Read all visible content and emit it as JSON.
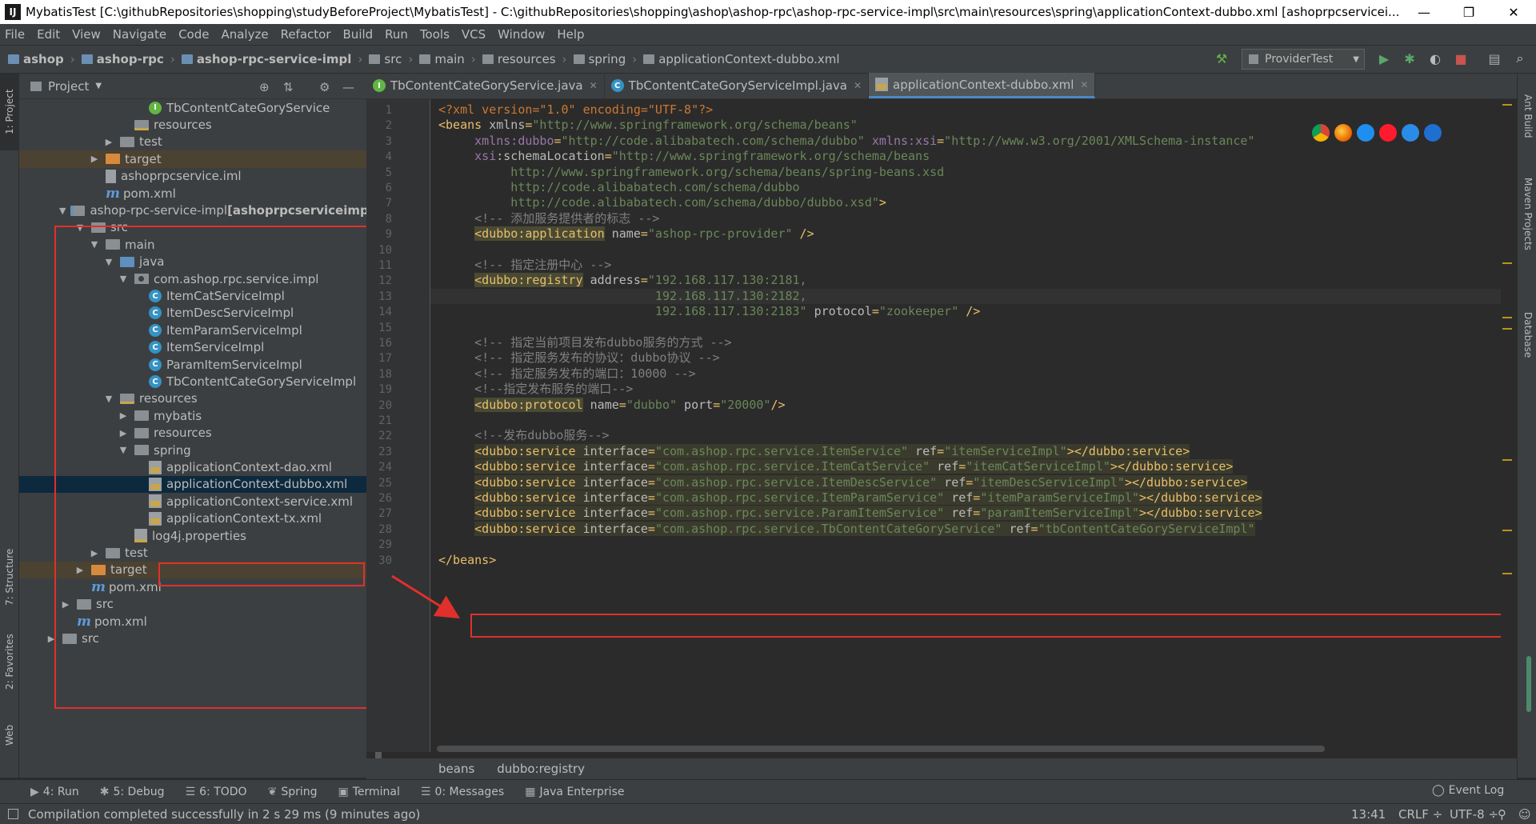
{
  "window": {
    "title": "MybatisTest [C:\\githubRepositories\\shopping\\studyBeforeProject\\MybatisTest] - C:\\githubRepositories\\shopping\\ashop\\ashop-rpc\\ashop-rpc-service-impl\\src\\main\\resources\\spring\\applicationContext-dubbo.xml [ashoprpcservicei...",
    "minimize": "—",
    "restore": "❐",
    "close": "✕"
  },
  "menu": [
    "File",
    "Edit",
    "View",
    "Navigate",
    "Code",
    "Analyze",
    "Refactor",
    "Build",
    "Run",
    "Tools",
    "VCS",
    "Window",
    "Help"
  ],
  "breadcrumb": [
    "ashop",
    "ashop-rpc",
    "ashop-rpc-service-impl",
    "src",
    "main",
    "resources",
    "spring",
    "applicationContext-dubbo.xml"
  ],
  "run_config": "ProviderTest",
  "project_panel": {
    "title": "Project",
    "tree": [
      {
        "label": "TbContentCateGoryService",
        "icon": "interface-icon",
        "indent": 7
      },
      {
        "label": "resources",
        "icon": "resources-folder-icon",
        "indent": 6
      },
      {
        "label": "test",
        "icon": "folder-icon",
        "indent": 5,
        "arrow": "▶"
      },
      {
        "label": "target",
        "icon": "target-folder-icon",
        "indent": 4,
        "arrow": "▶",
        "excluded": true
      },
      {
        "label": "ashoprpcservice.iml",
        "icon": "iml-file-icon",
        "indent": 4
      },
      {
        "label": "pom.xml",
        "icon": "maven-icon",
        "indent": 4
      },
      {
        "label": "ashop-rpc-service-impl",
        "suffix": " [ashoprpcserviceimpl]",
        "icon": "module-folder-icon",
        "indent": 2,
        "arrow": "▼"
      },
      {
        "label": "src",
        "icon": "folder-icon",
        "indent": 3,
        "arrow": "▼"
      },
      {
        "label": "main",
        "icon": "folder-icon",
        "indent": 4,
        "arrow": "▼"
      },
      {
        "label": "java",
        "icon": "source-folder-icon",
        "indent": 5,
        "arrow": "▼"
      },
      {
        "label": "com.ashop.rpc.service.impl",
        "icon": "package-icon",
        "indent": 6,
        "arrow": "▼"
      },
      {
        "label": "ItemCatServiceImpl",
        "icon": "class-icon",
        "indent": 7
      },
      {
        "label": "ItemDescServiceImpl",
        "icon": "class-icon",
        "indent": 7
      },
      {
        "label": "ItemParamServiceImpl",
        "icon": "class-icon",
        "indent": 7
      },
      {
        "label": "ItemServiceImpl",
        "icon": "class-icon",
        "indent": 7
      },
      {
        "label": "ParamItemServiceImpl",
        "icon": "class-icon",
        "indent": 7
      },
      {
        "label": "TbContentCateGoryServiceImpl",
        "icon": "class-icon",
        "indent": 7
      },
      {
        "label": "resources",
        "icon": "resources-folder-icon",
        "indent": 5,
        "arrow": "▼"
      },
      {
        "label": "mybatis",
        "icon": "folder-icon",
        "indent": 6,
        "arrow": "▶"
      },
      {
        "label": "resources",
        "icon": "folder-icon",
        "indent": 6,
        "arrow": "▶"
      },
      {
        "label": "spring",
        "icon": "folder-icon",
        "indent": 6,
        "arrow": "▼"
      },
      {
        "label": "applicationContext-dao.xml",
        "icon": "xml-file-icon",
        "indent": 7
      },
      {
        "label": "applicationContext-dubbo.xml",
        "icon": "xml-file-icon",
        "indent": 7,
        "selected": true
      },
      {
        "label": "applicationContext-service.xml",
        "icon": "xml-file-icon",
        "indent": 7
      },
      {
        "label": "applicationContext-tx.xml",
        "icon": "xml-file-icon",
        "indent": 7
      },
      {
        "label": "log4j.properties",
        "icon": "properties-file-icon",
        "indent": 6
      },
      {
        "label": "test",
        "icon": "folder-icon",
        "indent": 4,
        "arrow": "▶"
      },
      {
        "label": "target",
        "icon": "target-folder-icon",
        "indent": 3,
        "arrow": "▶",
        "excluded": true
      },
      {
        "label": "pom.xml",
        "icon": "maven-icon",
        "indent": 3
      },
      {
        "label": "src",
        "icon": "folder-icon",
        "indent": 2,
        "arrow": "▶"
      },
      {
        "label": "pom.xml",
        "icon": "maven-icon",
        "indent": 2
      },
      {
        "label": "src",
        "icon": "folder-icon",
        "indent": 1,
        "arrow": "▶"
      }
    ]
  },
  "tabs": [
    {
      "label": "TbContentCateGoryService.java",
      "icon": "interface-icon",
      "active": false
    },
    {
      "label": "TbContentCateGoryServiceImpl.java",
      "icon": "class-icon",
      "active": false
    },
    {
      "label": "applicationContext-dubbo.xml",
      "icon": "xml-file-icon",
      "active": true
    }
  ],
  "editor": {
    "lines": [
      [
        [
          "pi",
          "<?xml version=\"1.0\" encoding=\"UTF-8\"?>"
        ]
      ],
      [
        [
          "tag",
          "<beans "
        ],
        [
          "attr",
          "xmlns"
        ],
        [
          "tag",
          "="
        ],
        [
          "val",
          "\"http://www.springframework.org/schema/beans\""
        ]
      ],
      [
        [
          "txt",
          "     "
        ],
        [
          "ns",
          "xmlns:dubbo"
        ],
        [
          "tag",
          "="
        ],
        [
          "val",
          "\"http://code.alibabatech.com/schema/dubbo\""
        ],
        [
          "txt",
          " "
        ],
        [
          "ns",
          "xmlns:xsi"
        ],
        [
          "tag",
          "="
        ],
        [
          "val",
          "\"http://www.w3.org/2001/XMLSchema-instance\""
        ]
      ],
      [
        [
          "txt",
          "     "
        ],
        [
          "ns",
          "xsi"
        ],
        [
          "attr",
          ":schemaLocation"
        ],
        [
          "tag",
          "="
        ],
        [
          "val",
          "\"http://www.springframework.org/schema/beans"
        ]
      ],
      [
        [
          "val",
          "          http://www.springframework.org/schema/beans/spring-beans.xsd"
        ]
      ],
      [
        [
          "val",
          "          http://code.alibabatech.com/schema/dubbo"
        ]
      ],
      [
        [
          "val",
          "          http://code.alibabatech.com/schema/dubbo/dubbo.xsd\""
        ],
        [
          "tag",
          ">"
        ]
      ],
      [
        [
          "com",
          "     <!-- 添加服务提供者的标志 -->"
        ]
      ],
      [
        [
          "txt",
          "     "
        ],
        [
          "tagbg",
          "<dubbo:application"
        ],
        [
          "attr",
          " name"
        ],
        [
          "tag",
          "="
        ],
        [
          "val",
          "\"ashop-rpc-provider\""
        ],
        [
          "tag",
          " />"
        ]
      ],
      [],
      [
        [
          "com",
          "     <!-- 指定注册中心 -->"
        ]
      ],
      [
        [
          "txt",
          "     "
        ],
        [
          "tagbg",
          "<dubbo:registry"
        ],
        [
          "attr",
          " address"
        ],
        [
          "tag",
          "="
        ],
        [
          "val",
          "\"192.168.117.130:2181,"
        ]
      ],
      [
        [
          "val",
          "                              192.168.117.130:2182,"
        ]
      ],
      [
        [
          "val",
          "                              192.168.117.130:2183\""
        ],
        [
          "attr",
          " protocol"
        ],
        [
          "tag",
          "="
        ],
        [
          "val",
          "\"zookeeper\""
        ],
        [
          "tag",
          " />"
        ]
      ],
      [],
      [
        [
          "com",
          "     <!-- 指定当前项目发布dubbo服务的方式 -->"
        ]
      ],
      [
        [
          "com",
          "     <!-- 指定服务发布的协议：dubbo协议 -->"
        ]
      ],
      [
        [
          "com",
          "     <!-- 指定服务发布的端口：10000 -->"
        ]
      ],
      [
        [
          "com",
          "     <!--指定发布服务的端口-->"
        ]
      ],
      [
        [
          "txt",
          "     "
        ],
        [
          "tagbg",
          "<dubbo:protocol"
        ],
        [
          "attr",
          " name"
        ],
        [
          "tag",
          "="
        ],
        [
          "val",
          "\"dubbo\""
        ],
        [
          "attr",
          " port"
        ],
        [
          "tag",
          "="
        ],
        [
          "val",
          "\"20000\""
        ],
        [
          "tag",
          "/>"
        ]
      ],
      [],
      [
        [
          "com",
          "     <!--发布dubbo服务-->"
        ]
      ],
      [
        [
          "txt",
          "     "
        ],
        [
          "bgtag",
          "<dubbo:service"
        ],
        [
          "bgattr",
          " interface"
        ],
        [
          "bgtag",
          "="
        ],
        [
          "bgval",
          "\"com.ashop.rpc.service.ItemService\""
        ],
        [
          "bgattr",
          " ref"
        ],
        [
          "bgtag",
          "="
        ],
        [
          "bgval",
          "\"itemServiceImpl\""
        ],
        [
          "bgtag",
          "></dubbo:service>"
        ]
      ],
      [
        [
          "txt",
          "     "
        ],
        [
          "bgtag",
          "<dubbo:service"
        ],
        [
          "bgattr",
          " interface"
        ],
        [
          "bgtag",
          "="
        ],
        [
          "bgval",
          "\"com.ashop.rpc.service.ItemCatService\""
        ],
        [
          "bgattr",
          " ref"
        ],
        [
          "bgtag",
          "="
        ],
        [
          "bgval",
          "\"itemCatServiceImpl\""
        ],
        [
          "bgtag",
          "></dubbo:service>"
        ]
      ],
      [
        [
          "txt",
          "     "
        ],
        [
          "bgtag",
          "<dubbo:service"
        ],
        [
          "bgattr",
          " interface"
        ],
        [
          "bgtag",
          "="
        ],
        [
          "bgval",
          "\"com.ashop.rpc.service.ItemDescService\""
        ],
        [
          "bgattr",
          " ref"
        ],
        [
          "bgtag",
          "="
        ],
        [
          "bgval",
          "\"itemDescServiceImpl\""
        ],
        [
          "bgtag",
          "></dubbo:service>"
        ]
      ],
      [
        [
          "txt",
          "     "
        ],
        [
          "bgtag",
          "<dubbo:service"
        ],
        [
          "bgattr",
          " interface"
        ],
        [
          "bgtag",
          "="
        ],
        [
          "bgval",
          "\"com.ashop.rpc.service.ItemParamService\""
        ],
        [
          "bgattr",
          " ref"
        ],
        [
          "bgtag",
          "="
        ],
        [
          "bgval",
          "\"itemParamServiceImpl\""
        ],
        [
          "bgtag",
          "></dubbo:service>"
        ]
      ],
      [
        [
          "txt",
          "     "
        ],
        [
          "bgtag",
          "<dubbo:service"
        ],
        [
          "bgattr",
          " interface"
        ],
        [
          "bgtag",
          "="
        ],
        [
          "bgval",
          "\"com.ashop.rpc.service.ParamItemService\""
        ],
        [
          "bgattr",
          " ref"
        ],
        [
          "bgtag",
          "="
        ],
        [
          "bgval",
          "\"paramItemServiceImpl\""
        ],
        [
          "bgtag",
          "></dubbo:service>"
        ]
      ],
      [
        [
          "txt",
          "     "
        ],
        [
          "bgtag",
          "<dubbo:service"
        ],
        [
          "bgattr",
          " interface"
        ],
        [
          "bgtag",
          "="
        ],
        [
          "bgval",
          "\"com.ashop.rpc.service.TbContentCateGoryService\""
        ],
        [
          "bgattr",
          " ref"
        ],
        [
          "bgtag",
          "="
        ],
        [
          "bgval",
          "\"tbContentCateGoryServiceImpl\""
        ]
      ],
      [],
      [
        [
          "tag",
          "</beans>"
        ]
      ]
    ]
  },
  "editor_breadcrumb": [
    "beans",
    "dubbo:registry"
  ],
  "tool_windows": [
    {
      "icon": "▶",
      "label": "4: Run"
    },
    {
      "icon": "✱",
      "label": "5: Debug"
    },
    {
      "icon": "☰",
      "label": "6: TODO"
    },
    {
      "icon": "❦",
      "label": "Spring"
    },
    {
      "icon": "▣",
      "label": "Terminal"
    },
    {
      "icon": "☰",
      "label": "0: Messages"
    },
    {
      "icon": "▦",
      "label": "Java Enterprise"
    }
  ],
  "event_log": "Event Log",
  "left_stripe": [
    "1: Project",
    "7: Structure",
    "2: Favorites",
    "Web"
  ],
  "right_stripe": [
    "Ant Build",
    "Maven Projects",
    "Database"
  ],
  "status": {
    "message": "Compilation completed successfully in 2 s 29 ms (9 minutes ago)",
    "position": "13:41",
    "line_sep": "CRLF ÷",
    "encoding": "UTF-8 ÷"
  },
  "colors": {
    "highlight_box": "#e0302c",
    "selection": "#0d293e",
    "accent": "#4a88c7"
  }
}
